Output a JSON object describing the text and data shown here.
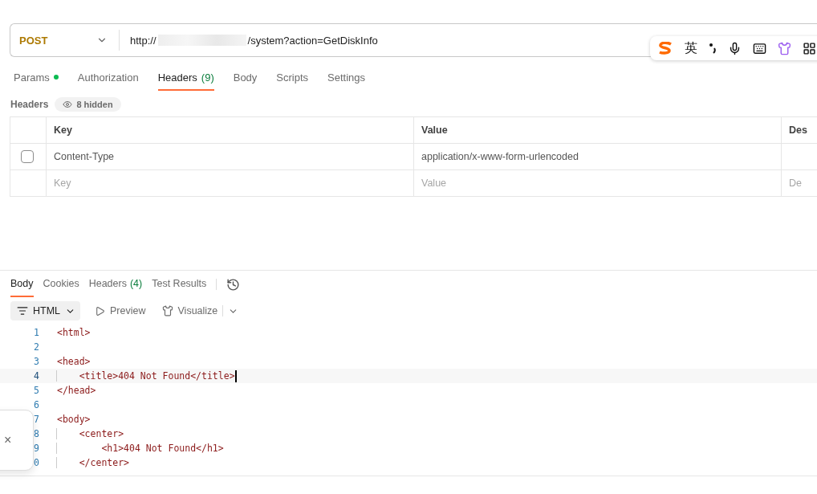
{
  "request": {
    "method": "POST",
    "url_prefix": "http://",
    "url_suffix": "/system?action=GetDiskInfo"
  },
  "request_tabs": [
    {
      "label": "Params",
      "dot": true,
      "selected": false
    },
    {
      "label": "Authorization",
      "dot": false,
      "selected": false
    },
    {
      "label": "Headers",
      "count": "(9)",
      "dot": false,
      "selected": true
    },
    {
      "label": "Body",
      "dot": false,
      "selected": false
    },
    {
      "label": "Scripts",
      "dot": false,
      "selected": false
    },
    {
      "label": "Settings",
      "dot": false,
      "selected": false
    }
  ],
  "headers_bar": {
    "title": "Headers",
    "hidden_badge": "8 hidden"
  },
  "table": {
    "columns": [
      "Key",
      "Value",
      "Des"
    ],
    "rows": [
      {
        "kind": "entry",
        "checked": false,
        "key": "Content-Type",
        "value": "application/x-www-form-urlencoded"
      },
      {
        "kind": "placeholder",
        "key": "Key",
        "value": "Value",
        "description": "De"
      }
    ]
  },
  "response_tabs": [
    {
      "label": "Body",
      "selected": true
    },
    {
      "label": "Cookies",
      "selected": false
    },
    {
      "label": "Headers",
      "count": "(4)",
      "selected": false
    },
    {
      "label": "Test Results",
      "selected": false
    }
  ],
  "format_bar": {
    "format": "HTML",
    "preview": "Preview",
    "visualize": "Visualize"
  },
  "code": [
    {
      "number": "1",
      "text": "<html>",
      "selected": false
    },
    {
      "number": "2",
      "selected": false
    },
    {
      "number": "3",
      "text": "<head>",
      "selected": false
    },
    {
      "number": "4",
      "text": "    <title>404 Not Found</title>",
      "selected": true
    },
    {
      "number": "5",
      "text": "</head>",
      "selected": false
    },
    {
      "number": "6",
      "selected": false
    },
    {
      "number": "7",
      "text": "<body>",
      "selected": false
    },
    {
      "number": "8",
      "text": "    <center>",
      "selected": false
    },
    {
      "number": "9",
      "text": "        <h1>404 Not Found</h1>",
      "selected": false
    },
    {
      "number": "0",
      "text": "    </center>",
      "selected": false
    }
  ],
  "ime_toolbar": {
    "language": "英"
  },
  "toast": {
    "close": "×"
  }
}
